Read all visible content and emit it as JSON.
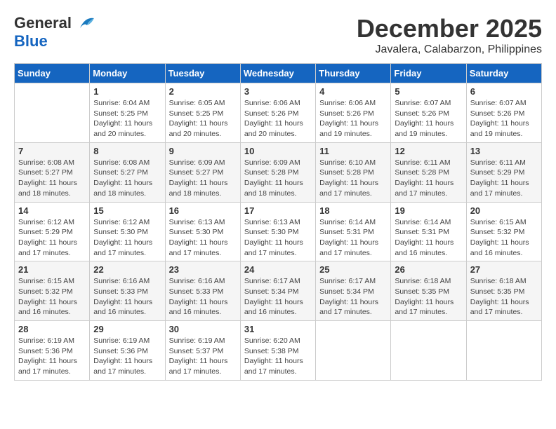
{
  "header": {
    "logo_general": "General",
    "logo_blue": "Blue",
    "month_title": "December 2025",
    "location": "Javalera, Calabarzon, Philippines"
  },
  "days_of_week": [
    "Sunday",
    "Monday",
    "Tuesday",
    "Wednesday",
    "Thursday",
    "Friday",
    "Saturday"
  ],
  "weeks": [
    [
      {
        "day": "",
        "sunrise": "",
        "sunset": "",
        "daylight": ""
      },
      {
        "day": "1",
        "sunrise": "Sunrise: 6:04 AM",
        "sunset": "Sunset: 5:25 PM",
        "daylight": "Daylight: 11 hours and 20 minutes."
      },
      {
        "day": "2",
        "sunrise": "Sunrise: 6:05 AM",
        "sunset": "Sunset: 5:25 PM",
        "daylight": "Daylight: 11 hours and 20 minutes."
      },
      {
        "day": "3",
        "sunrise": "Sunrise: 6:06 AM",
        "sunset": "Sunset: 5:26 PM",
        "daylight": "Daylight: 11 hours and 20 minutes."
      },
      {
        "day": "4",
        "sunrise": "Sunrise: 6:06 AM",
        "sunset": "Sunset: 5:26 PM",
        "daylight": "Daylight: 11 hours and 19 minutes."
      },
      {
        "day": "5",
        "sunrise": "Sunrise: 6:07 AM",
        "sunset": "Sunset: 5:26 PM",
        "daylight": "Daylight: 11 hours and 19 minutes."
      },
      {
        "day": "6",
        "sunrise": "Sunrise: 6:07 AM",
        "sunset": "Sunset: 5:26 PM",
        "daylight": "Daylight: 11 hours and 19 minutes."
      }
    ],
    [
      {
        "day": "7",
        "sunrise": "Sunrise: 6:08 AM",
        "sunset": "Sunset: 5:27 PM",
        "daylight": "Daylight: 11 hours and 18 minutes."
      },
      {
        "day": "8",
        "sunrise": "Sunrise: 6:08 AM",
        "sunset": "Sunset: 5:27 PM",
        "daylight": "Daylight: 11 hours and 18 minutes."
      },
      {
        "day": "9",
        "sunrise": "Sunrise: 6:09 AM",
        "sunset": "Sunset: 5:27 PM",
        "daylight": "Daylight: 11 hours and 18 minutes."
      },
      {
        "day": "10",
        "sunrise": "Sunrise: 6:09 AM",
        "sunset": "Sunset: 5:28 PM",
        "daylight": "Daylight: 11 hours and 18 minutes."
      },
      {
        "day": "11",
        "sunrise": "Sunrise: 6:10 AM",
        "sunset": "Sunset: 5:28 PM",
        "daylight": "Daylight: 11 hours and 17 minutes."
      },
      {
        "day": "12",
        "sunrise": "Sunrise: 6:11 AM",
        "sunset": "Sunset: 5:28 PM",
        "daylight": "Daylight: 11 hours and 17 minutes."
      },
      {
        "day": "13",
        "sunrise": "Sunrise: 6:11 AM",
        "sunset": "Sunset: 5:29 PM",
        "daylight": "Daylight: 11 hours and 17 minutes."
      }
    ],
    [
      {
        "day": "14",
        "sunrise": "Sunrise: 6:12 AM",
        "sunset": "Sunset: 5:29 PM",
        "daylight": "Daylight: 11 hours and 17 minutes."
      },
      {
        "day": "15",
        "sunrise": "Sunrise: 6:12 AM",
        "sunset": "Sunset: 5:30 PM",
        "daylight": "Daylight: 11 hours and 17 minutes."
      },
      {
        "day": "16",
        "sunrise": "Sunrise: 6:13 AM",
        "sunset": "Sunset: 5:30 PM",
        "daylight": "Daylight: 11 hours and 17 minutes."
      },
      {
        "day": "17",
        "sunrise": "Sunrise: 6:13 AM",
        "sunset": "Sunset: 5:30 PM",
        "daylight": "Daylight: 11 hours and 17 minutes."
      },
      {
        "day": "18",
        "sunrise": "Sunrise: 6:14 AM",
        "sunset": "Sunset: 5:31 PM",
        "daylight": "Daylight: 11 hours and 17 minutes."
      },
      {
        "day": "19",
        "sunrise": "Sunrise: 6:14 AM",
        "sunset": "Sunset: 5:31 PM",
        "daylight": "Daylight: 11 hours and 16 minutes."
      },
      {
        "day": "20",
        "sunrise": "Sunrise: 6:15 AM",
        "sunset": "Sunset: 5:32 PM",
        "daylight": "Daylight: 11 hours and 16 minutes."
      }
    ],
    [
      {
        "day": "21",
        "sunrise": "Sunrise: 6:15 AM",
        "sunset": "Sunset: 5:32 PM",
        "daylight": "Daylight: 11 hours and 16 minutes."
      },
      {
        "day": "22",
        "sunrise": "Sunrise: 6:16 AM",
        "sunset": "Sunset: 5:33 PM",
        "daylight": "Daylight: 11 hours and 16 minutes."
      },
      {
        "day": "23",
        "sunrise": "Sunrise: 6:16 AM",
        "sunset": "Sunset: 5:33 PM",
        "daylight": "Daylight: 11 hours and 16 minutes."
      },
      {
        "day": "24",
        "sunrise": "Sunrise: 6:17 AM",
        "sunset": "Sunset: 5:34 PM",
        "daylight": "Daylight: 11 hours and 16 minutes."
      },
      {
        "day": "25",
        "sunrise": "Sunrise: 6:17 AM",
        "sunset": "Sunset: 5:34 PM",
        "daylight": "Daylight: 11 hours and 17 minutes."
      },
      {
        "day": "26",
        "sunrise": "Sunrise: 6:18 AM",
        "sunset": "Sunset: 5:35 PM",
        "daylight": "Daylight: 11 hours and 17 minutes."
      },
      {
        "day": "27",
        "sunrise": "Sunrise: 6:18 AM",
        "sunset": "Sunset: 5:35 PM",
        "daylight": "Daylight: 11 hours and 17 minutes."
      }
    ],
    [
      {
        "day": "28",
        "sunrise": "Sunrise: 6:19 AM",
        "sunset": "Sunset: 5:36 PM",
        "daylight": "Daylight: 11 hours and 17 minutes."
      },
      {
        "day": "29",
        "sunrise": "Sunrise: 6:19 AM",
        "sunset": "Sunset: 5:36 PM",
        "daylight": "Daylight: 11 hours and 17 minutes."
      },
      {
        "day": "30",
        "sunrise": "Sunrise: 6:19 AM",
        "sunset": "Sunset: 5:37 PM",
        "daylight": "Daylight: 11 hours and 17 minutes."
      },
      {
        "day": "31",
        "sunrise": "Sunrise: 6:20 AM",
        "sunset": "Sunset: 5:38 PM",
        "daylight": "Daylight: 11 hours and 17 minutes."
      },
      {
        "day": "",
        "sunrise": "",
        "sunset": "",
        "daylight": ""
      },
      {
        "day": "",
        "sunrise": "",
        "sunset": "",
        "daylight": ""
      },
      {
        "day": "",
        "sunrise": "",
        "sunset": "",
        "daylight": ""
      }
    ]
  ]
}
